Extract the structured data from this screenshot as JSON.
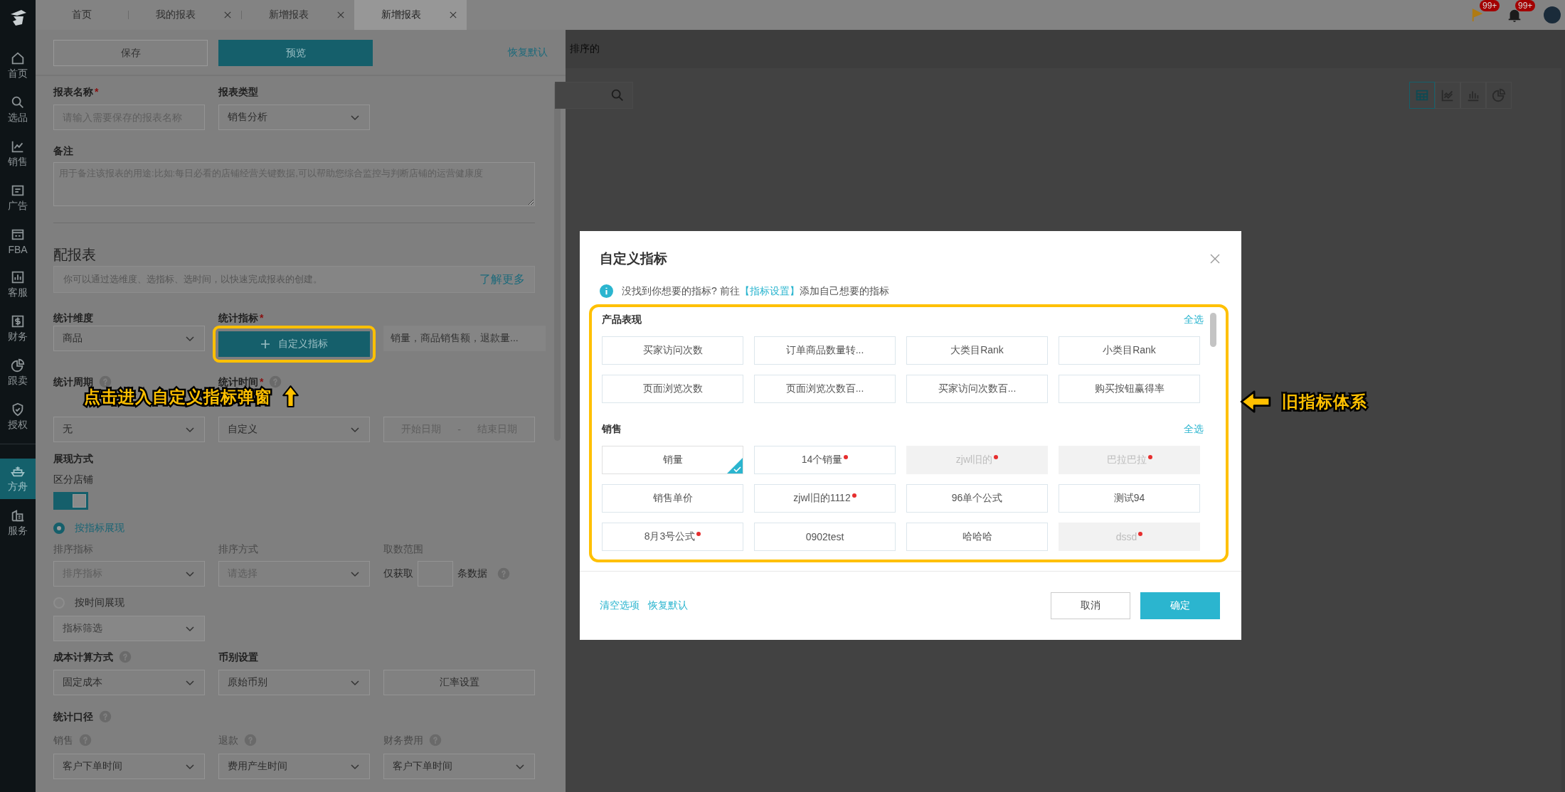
{
  "sidebar": {
    "items": [
      {
        "label": "首页",
        "selected": false
      },
      {
        "label": "选品",
        "selected": false
      },
      {
        "label": "销售",
        "selected": false
      },
      {
        "label": "广告",
        "selected": false
      },
      {
        "label": "FBA",
        "selected": false
      },
      {
        "label": "客服",
        "selected": false
      },
      {
        "label": "财务",
        "selected": false
      },
      {
        "label": "跟卖",
        "selected": false
      },
      {
        "label": "授权",
        "selected": false
      },
      {
        "label": "方舟",
        "selected": true
      },
      {
        "label": "服务",
        "selected": false
      }
    ]
  },
  "tabs": [
    {
      "label": "首页",
      "closable": false,
      "selected": false
    },
    {
      "label": "我的报表",
      "closable": true,
      "selected": false
    },
    {
      "label": "新增报表",
      "closable": true,
      "selected": false
    },
    {
      "label": "新增报表",
      "closable": true,
      "selected": true
    }
  ],
  "header_badges": [
    {
      "count": "99+"
    },
    {
      "count": "99+"
    }
  ],
  "drawer": {
    "save_button": "保存",
    "preview_button": "预览",
    "reset_link": "恢复默认",
    "report_name": {
      "label": "报表名称",
      "required_mark": "*",
      "placeholder": "请输入需要保存的报表名称"
    },
    "report_type": {
      "label": "报表类型",
      "value": "销售分析"
    },
    "remark": {
      "label": "备注",
      "placeholder": "用于备注该报表的用途:比如:每日必看的店铺经营关键数据,可以帮助您综合监控与判断店铺的运营健康度"
    },
    "section_title": "配报表",
    "info_text": "你可以通过选维度、选指标、选时间，以快速完成报表的创建。",
    "info_link": "了解更多",
    "dimension": {
      "label": "统计维度",
      "value": "商品"
    },
    "metrics": {
      "label": "统计指标",
      "required_mark": "*",
      "button": "自定义指标",
      "summary": "销量，商品销售额，退款量..."
    },
    "period": {
      "label": "统计周期",
      "help": true,
      "value": "无"
    },
    "time": {
      "label": "统计时间",
      "required_mark": "*",
      "help": true,
      "value": "自定义"
    },
    "date_range": {
      "start_placeholder": "开始日期",
      "separator": "-",
      "end_placeholder": "结束日期"
    },
    "display_title": "展现方式",
    "shop_split": {
      "label": "区分店铺",
      "on": true
    },
    "display_modes": [
      {
        "label": "按指标展现",
        "selected": true
      },
      {
        "label": "按时间展现",
        "selected": false
      }
    ],
    "sort_metric": {
      "label": "排序指标",
      "placeholder": "排序指标"
    },
    "sort_order": {
      "label": "排序方式",
      "placeholder": "请选择"
    },
    "range": {
      "label": "取数范围",
      "prefix": "仅获取",
      "suffix": "条数据",
      "help": true
    },
    "metric_filter": {
      "placeholder": "指标筛选",
      "disabled": true
    },
    "cost": {
      "label": "成本计算方式",
      "help": true,
      "value": "固定成本"
    },
    "currency": {
      "label": "币别设置",
      "value": "原始币别"
    },
    "rate_button": "汇率设置",
    "basis_title": {
      "label": "统计口径",
      "help": true
    },
    "basis": [
      {
        "label": "销售",
        "help": true,
        "value": "客户下单时间"
      },
      {
        "label": "退款",
        "help": true,
        "value": "费用产生时间"
      },
      {
        "label": "财务费用",
        "help": true,
        "value": "客户下单时间"
      }
    ]
  },
  "background": {
    "partial_text": "排序的",
    "view_toggles": [
      {
        "selected": true
      },
      {
        "selected": false
      },
      {
        "selected": false
      },
      {
        "selected": false
      }
    ]
  },
  "modal": {
    "title": "自定义指标",
    "info_text": "没找到你想要的指标? 前往",
    "info_link": "【指标设置】",
    "info_suffix": "添加自己想要的指标",
    "groups": [
      {
        "title": "产品表现",
        "select_all": "全选",
        "items": [
          {
            "label": "买家访问次数",
            "selected": false,
            "disabled": false,
            "flagged": false
          },
          {
            "label": "订单商品数量转...",
            "selected": false,
            "disabled": false,
            "flagged": false
          },
          {
            "label": "大类目Rank",
            "selected": false,
            "disabled": false,
            "flagged": false
          },
          {
            "label": "小类目Rank",
            "selected": false,
            "disabled": false,
            "flagged": false
          },
          {
            "label": "页面浏览次数",
            "selected": false,
            "disabled": false,
            "flagged": false
          },
          {
            "label": "页面浏览次数百...",
            "selected": false,
            "disabled": false,
            "flagged": false
          },
          {
            "label": "买家访问次数百...",
            "selected": false,
            "disabled": false,
            "flagged": false
          },
          {
            "label": "购买按钮赢得率",
            "selected": false,
            "disabled": false,
            "flagged": false
          }
        ]
      },
      {
        "title": "销售",
        "select_all": "全选",
        "items": [
          {
            "label": "销量",
            "selected": true,
            "disabled": false,
            "flagged": false
          },
          {
            "label": "14个销量",
            "selected": false,
            "disabled": false,
            "flagged": true
          },
          {
            "label": "zjwl旧的",
            "selected": false,
            "disabled": true,
            "flagged": true
          },
          {
            "label": "巴拉巴拉",
            "selected": false,
            "disabled": true,
            "flagged": true
          },
          {
            "label": "销售单价",
            "selected": false,
            "disabled": false,
            "flagged": false
          },
          {
            "label": "zjwl旧的1112",
            "selected": false,
            "disabled": false,
            "flagged": true
          },
          {
            "label": "96单个公式",
            "selected": false,
            "disabled": false,
            "flagged": false
          },
          {
            "label": "测试94",
            "selected": false,
            "disabled": false,
            "flagged": false
          },
          {
            "label": "8月3号公式",
            "selected": false,
            "disabled": false,
            "flagged": true
          },
          {
            "label": "0902test",
            "selected": false,
            "disabled": false,
            "flagged": false
          },
          {
            "label": "哈哈哈",
            "selected": false,
            "disabled": false,
            "flagged": false
          },
          {
            "label": "dssd",
            "selected": false,
            "disabled": true,
            "flagged": true
          }
        ]
      }
    ],
    "footer_links": [
      "清空选项",
      "恢复默认"
    ],
    "cancel_button": "取消",
    "confirm_button": "确定"
  },
  "annotations": [
    {
      "text": "点击进入自定义指标弹窗"
    },
    {
      "text": "旧指标体系"
    }
  ]
}
